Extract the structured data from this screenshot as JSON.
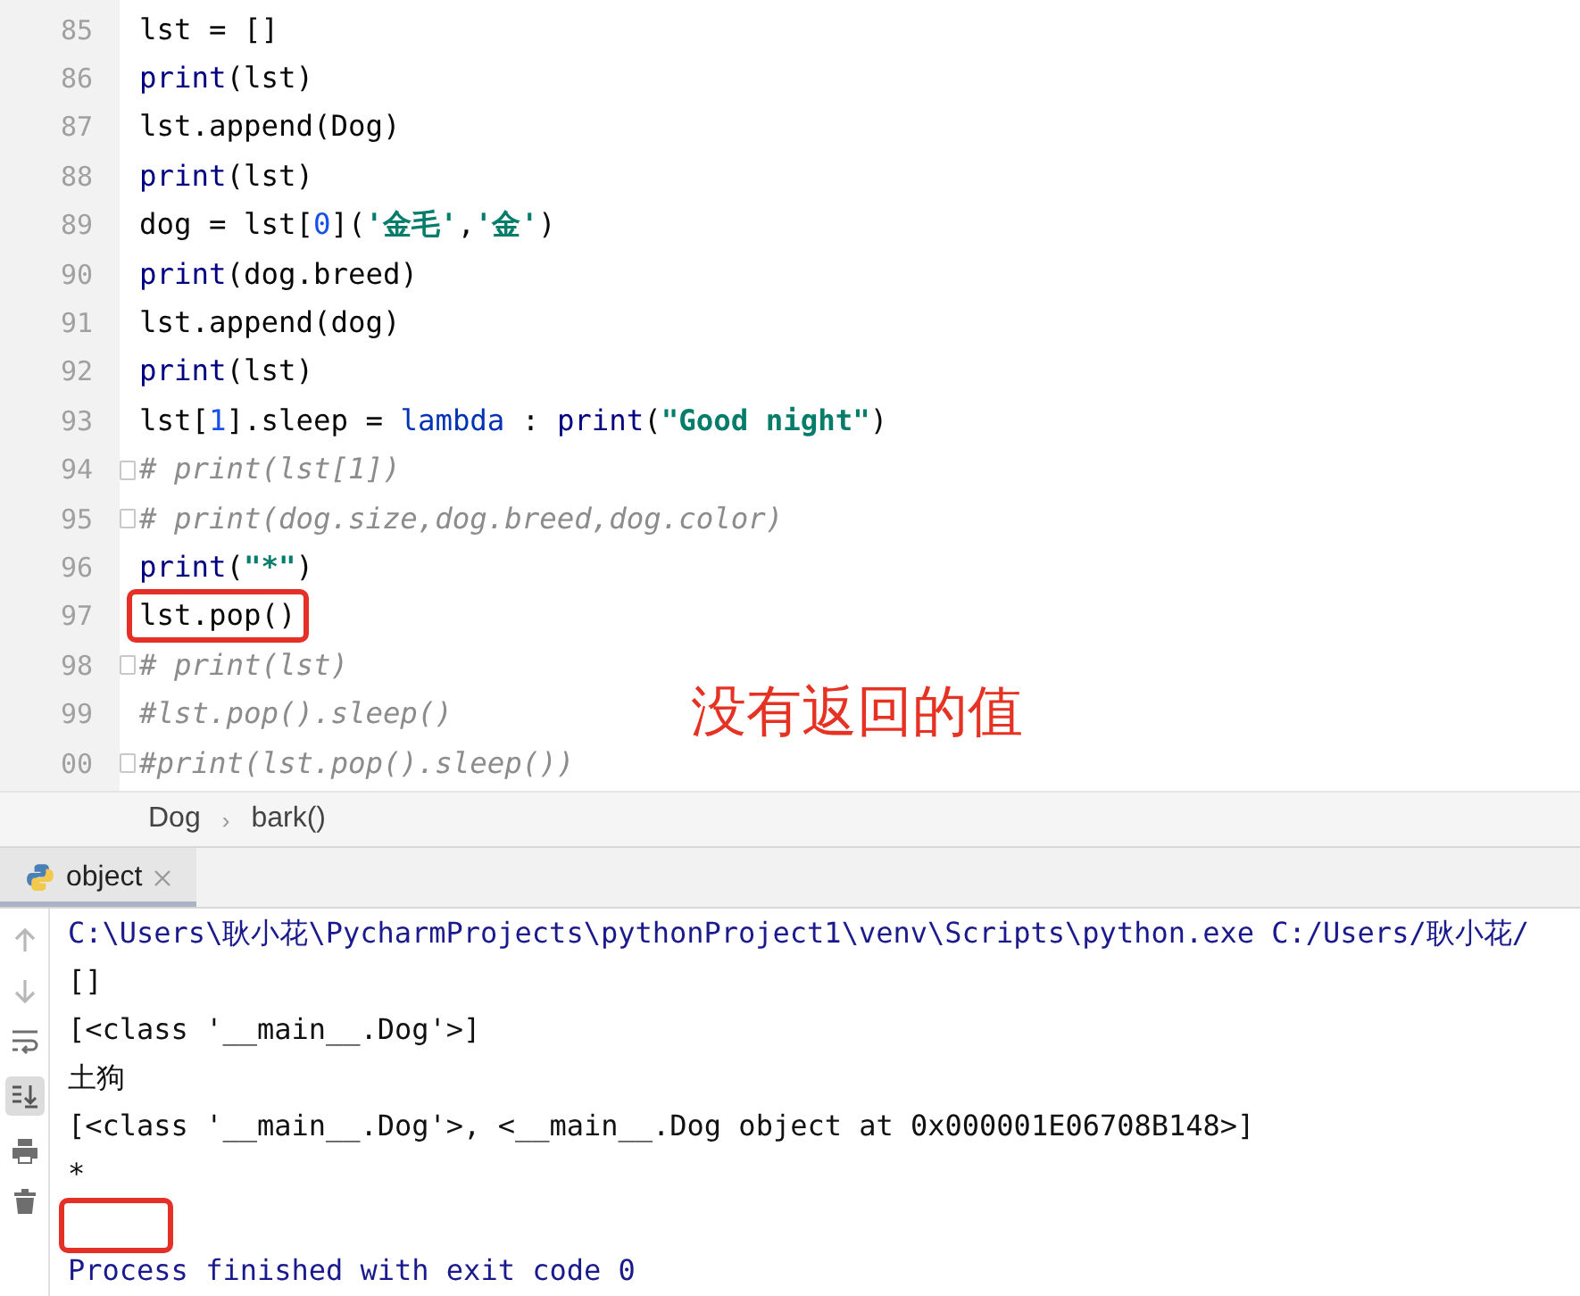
{
  "editor": {
    "lines": [
      {
        "number": "85",
        "tokens": [
          {
            "text": "lst = []",
            "kind": "text"
          }
        ]
      },
      {
        "number": "86",
        "tokens": [
          {
            "text": "print",
            "kind": "builtin"
          },
          {
            "text": "(lst)",
            "kind": "text"
          }
        ]
      },
      {
        "number": "87",
        "tokens": [
          {
            "text": "lst.append(Dog)",
            "kind": "text"
          }
        ]
      },
      {
        "number": "88",
        "tokens": [
          {
            "text": "print",
            "kind": "builtin"
          },
          {
            "text": "(lst)",
            "kind": "text"
          }
        ]
      },
      {
        "number": "89",
        "tokens": [
          {
            "text": "dog = lst[",
            "kind": "text"
          },
          {
            "text": "0",
            "kind": "number"
          },
          {
            "text": "](",
            "kind": "text"
          },
          {
            "text": "'金毛'",
            "kind": "string"
          },
          {
            "text": ",",
            "kind": "text"
          },
          {
            "text": "'金'",
            "kind": "string"
          },
          {
            "text": ")",
            "kind": "text"
          }
        ]
      },
      {
        "number": "90",
        "tokens": [
          {
            "text": "print",
            "kind": "builtin"
          },
          {
            "text": "(dog.breed)",
            "kind": "text"
          }
        ]
      },
      {
        "number": "91",
        "tokens": [
          {
            "text": "lst.append(dog)",
            "kind": "text"
          }
        ]
      },
      {
        "number": "92",
        "tokens": [
          {
            "text": "print",
            "kind": "builtin"
          },
          {
            "text": "(lst)",
            "kind": "text"
          }
        ]
      },
      {
        "number": "93",
        "tokens": [
          {
            "text": "lst[",
            "kind": "text"
          },
          {
            "text": "1",
            "kind": "number"
          },
          {
            "text": "].sleep = ",
            "kind": "text"
          },
          {
            "text": "lambda",
            "kind": "keyword"
          },
          {
            "text": " : ",
            "kind": "text"
          },
          {
            "text": "print",
            "kind": "builtin"
          },
          {
            "text": "(",
            "kind": "text"
          },
          {
            "text": "\"Good night\"",
            "kind": "string"
          },
          {
            "text": ")",
            "kind": "text"
          }
        ]
      },
      {
        "number": "94",
        "fold": true,
        "tokens": [
          {
            "text": "# print(lst[1])",
            "kind": "comment"
          }
        ]
      },
      {
        "number": "95",
        "fold": true,
        "tokens": [
          {
            "text": "# print(dog.size,dog.breed,dog.color)",
            "kind": "comment"
          }
        ]
      },
      {
        "number": "96",
        "tokens": [
          {
            "text": "print",
            "kind": "builtin"
          },
          {
            "text": "(",
            "kind": "text"
          },
          {
            "text": "\"*\"",
            "kind": "string"
          },
          {
            "text": ")",
            "kind": "text"
          }
        ]
      },
      {
        "number": "97",
        "boxed": true,
        "tokens": [
          {
            "text": "lst.pop()",
            "kind": "text"
          }
        ]
      },
      {
        "number": "98",
        "fold": true,
        "tokens": [
          {
            "text": "# print(lst)",
            "kind": "comment"
          }
        ]
      },
      {
        "number": "99",
        "tokens": [
          {
            "text": "#lst.pop().sleep()",
            "kind": "comment"
          }
        ]
      },
      {
        "number": "00",
        "fold": true,
        "tokens": [
          {
            "text": "#print(lst.pop().sleep())",
            "kind": "comment"
          }
        ]
      }
    ],
    "annotation": "没有返回的值"
  },
  "breadcrumbs": [
    "Dog",
    "›",
    "bark()"
  ],
  "run_tab": {
    "label": "object",
    "selected": true
  },
  "console": {
    "lines": [
      {
        "kind": "command",
        "text": "C:\\Users\\耿小花\\PycharmProjects\\pythonProject1\\venv\\Scripts\\python.exe C:/Users/耿小花/"
      },
      {
        "kind": "output",
        "text": "[]"
      },
      {
        "kind": "output",
        "text": "[<class '__main__.Dog'>]"
      },
      {
        "kind": "output",
        "text": "土狗"
      },
      {
        "kind": "output",
        "text": "[<class '__main__.Dog'>, <__main__.Dog object at 0x000001E06708B148>]"
      },
      {
        "kind": "output",
        "text": "*"
      },
      {
        "kind": "empty",
        "boxed": true
      },
      {
        "kind": "exit",
        "text": "Process finished with exit code 0"
      }
    ]
  }
}
